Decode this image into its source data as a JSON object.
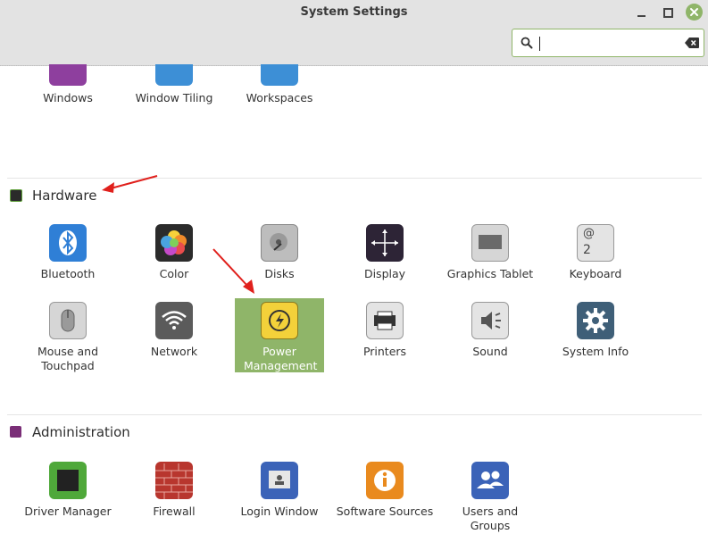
{
  "window": {
    "title": "System Settings"
  },
  "search": {
    "value": "",
    "placeholder": ""
  },
  "colors": {
    "accent": "#8fb569",
    "selection": "#8fb569",
    "arrow": "#e0201c"
  },
  "top_partial": [
    {
      "label": "Windows",
      "icon": "windows-icon"
    },
    {
      "label": "Window Tiling",
      "icon": "window-tiling-icon"
    },
    {
      "label": "Workspaces",
      "icon": "workspaces-icon"
    }
  ],
  "hardware": {
    "title": "Hardware",
    "items": [
      {
        "label": "Bluetooth",
        "icon": "bluetooth-icon"
      },
      {
        "label": "Color",
        "icon": "color-icon"
      },
      {
        "label": "Disks",
        "icon": "disks-icon"
      },
      {
        "label": "Display",
        "icon": "display-icon"
      },
      {
        "label": "Graphics Tablet",
        "icon": "graphics-tablet-icon"
      },
      {
        "label": "Keyboard",
        "icon": "keyboard-icon"
      },
      {
        "label": "Mouse and Touchpad",
        "icon": "mouse-icon"
      },
      {
        "label": "Network",
        "icon": "network-icon"
      },
      {
        "label": "Power Management",
        "icon": "power-icon",
        "selected": true
      },
      {
        "label": "Printers",
        "icon": "printer-icon"
      },
      {
        "label": "Sound",
        "icon": "sound-icon"
      },
      {
        "label": "System Info",
        "icon": "system-info-icon"
      }
    ]
  },
  "administration": {
    "title": "Administration",
    "items": [
      {
        "label": "Driver Manager",
        "icon": "driver-manager-icon"
      },
      {
        "label": "Firewall",
        "icon": "firewall-icon"
      },
      {
        "label": "Login Window",
        "icon": "login-window-icon"
      },
      {
        "label": "Software Sources",
        "icon": "software-sources-icon"
      },
      {
        "label": "Users and Groups",
        "icon": "users-groups-icon"
      }
    ]
  },
  "keyboard_icon_glyphs": {
    "top": "@",
    "bottom": "2"
  }
}
